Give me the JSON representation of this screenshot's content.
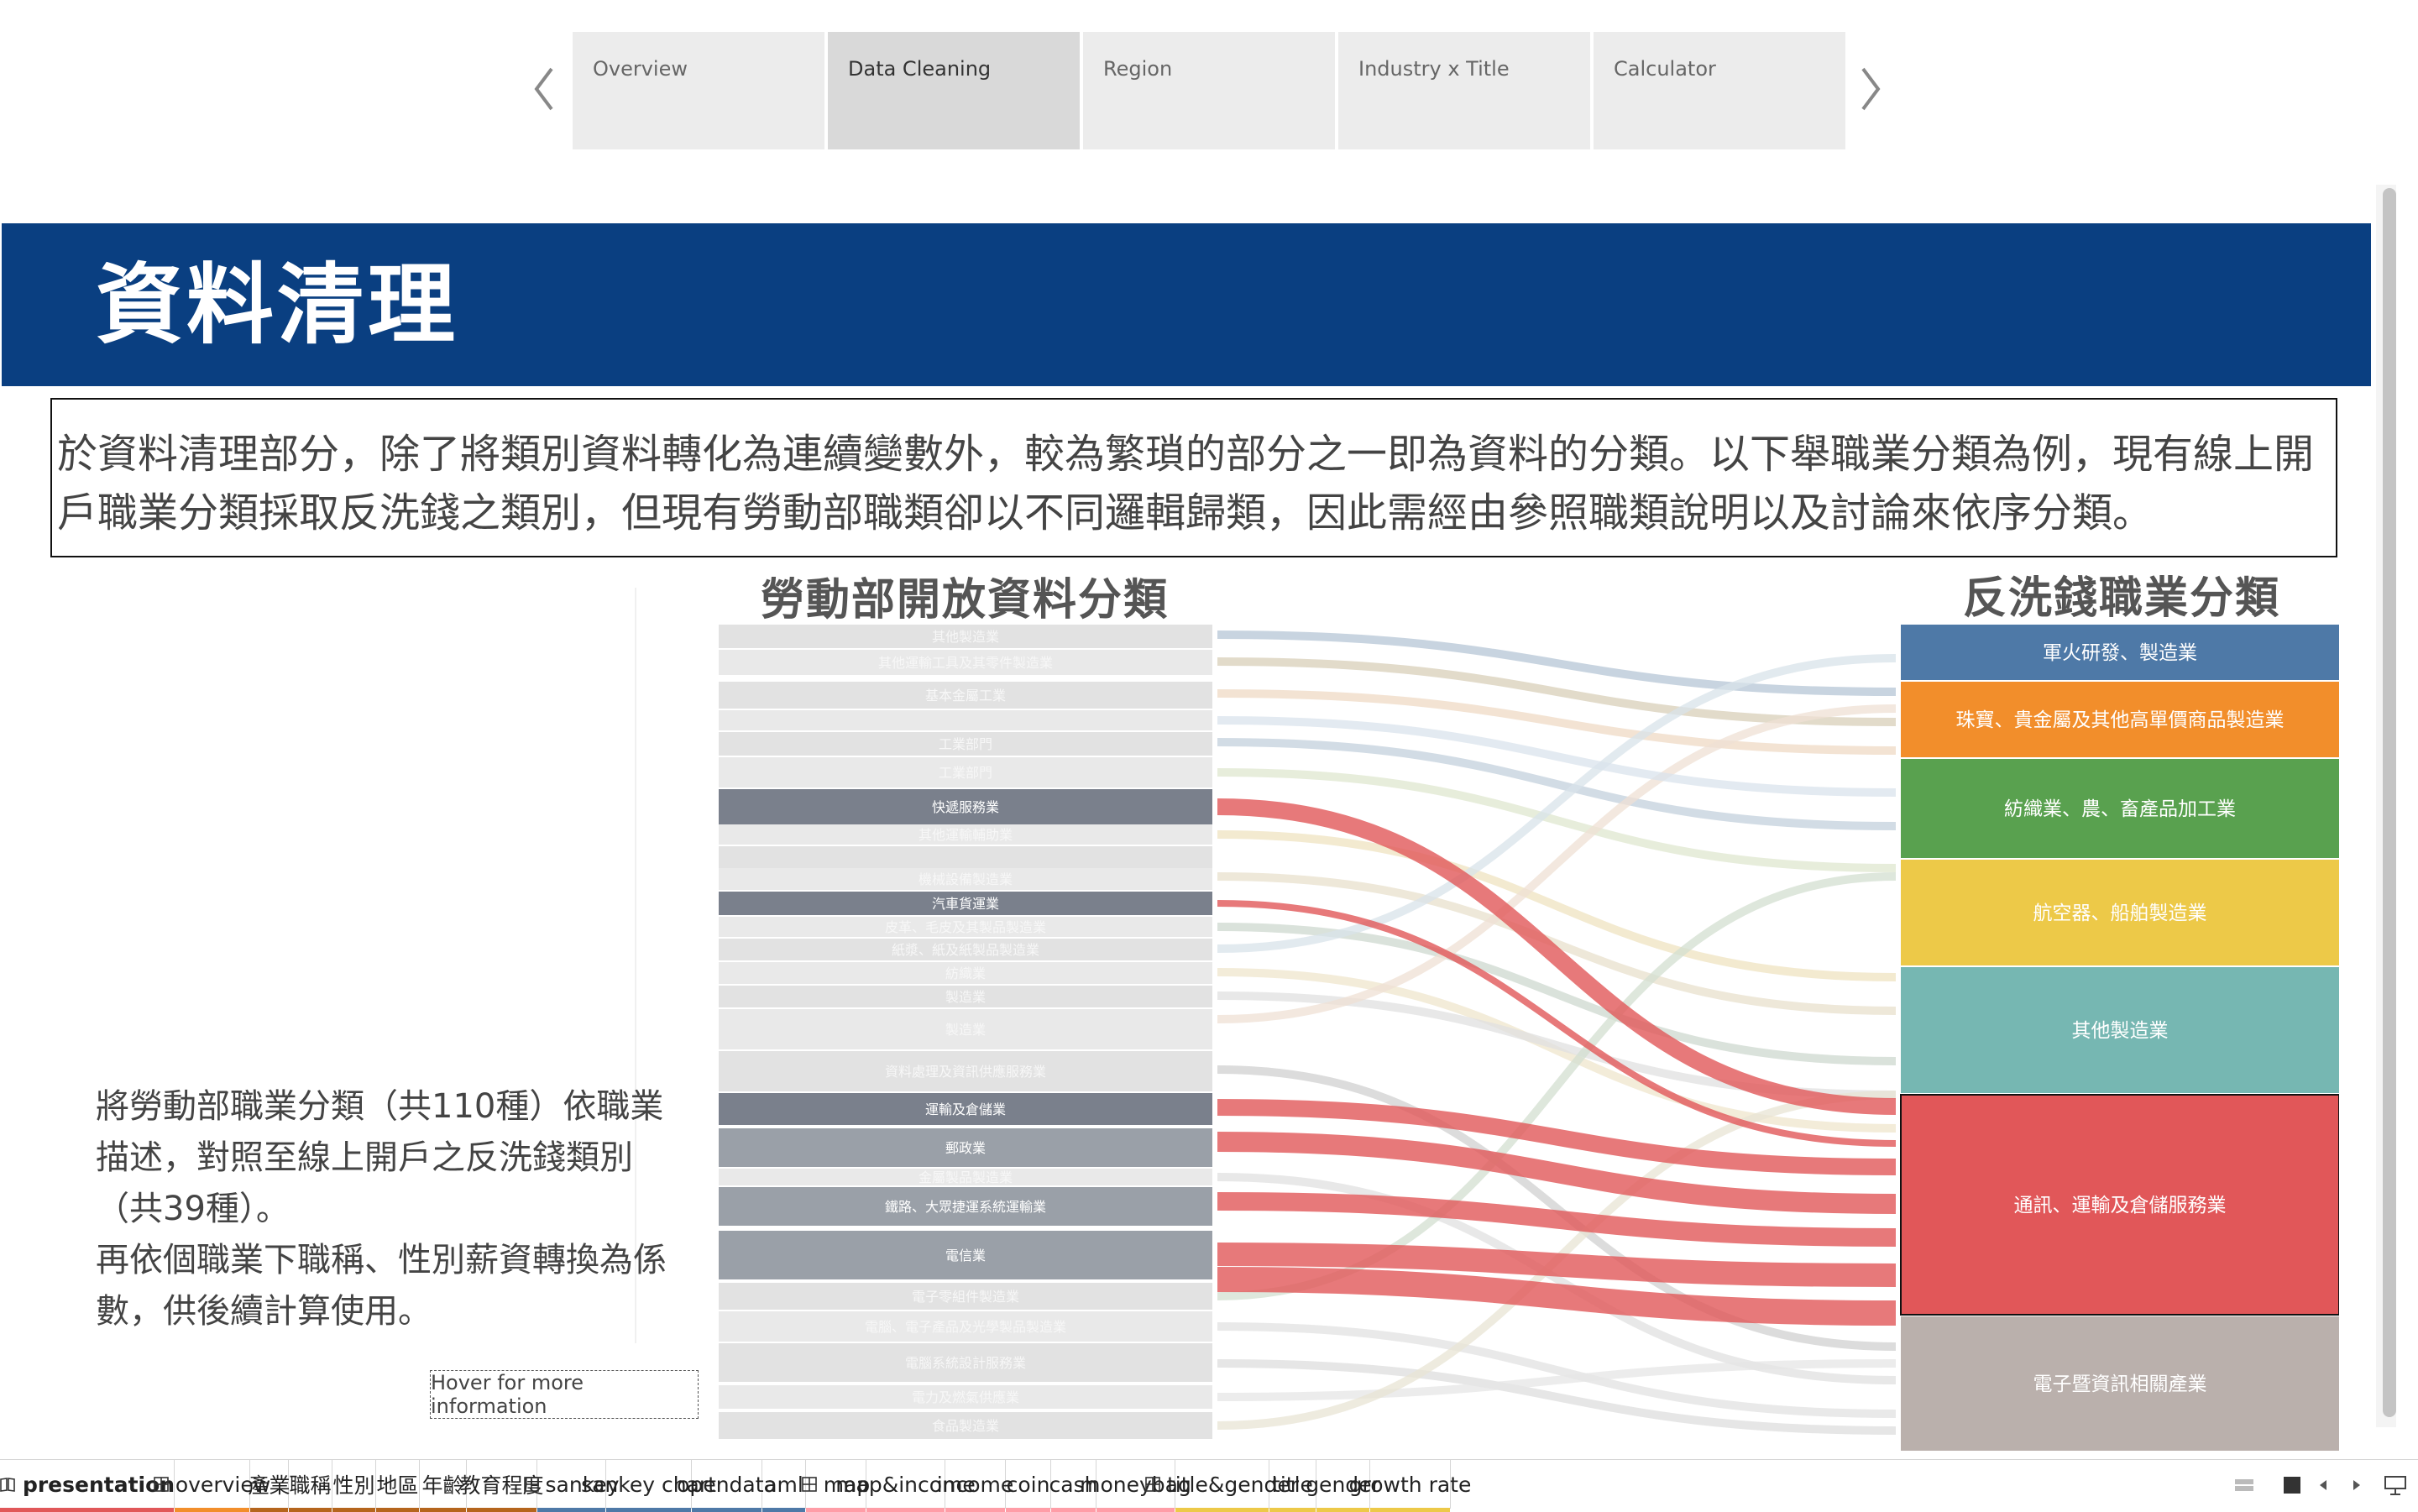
{
  "story": {
    "points": [
      {
        "label": "Overview",
        "active": false
      },
      {
        "label": "Data Cleaning",
        "active": true
      },
      {
        "label": "Region",
        "active": false
      },
      {
        "label": "Industry x Title",
        "active": false
      },
      {
        "label": "Calculator",
        "active": false
      }
    ]
  },
  "header": {
    "title": "資料清理"
  },
  "intro": {
    "text": "於資料清理部分，除了將類別資料轉化為連續變數外，較為繁瑣的部分之一即為資料的分類。以下舉職業分類為例，現有線上開戶職業分類採取反洗錢之類別，但現有勞動部職類卻以不同邏輯歸類，因此需經由參照職類說明以及討論來依序分類。"
  },
  "side_note": {
    "line1": "將勞動部職業分類（共110種）依職業描述，對照至線上開戶之反洗錢類別（共39種）。",
    "line2": "再依個職業下職稱、性別薪資轉換為係數，供後續計算使用。"
  },
  "hover_button": "Hover for more information",
  "sankey": {
    "left_title": "勞動部開放資料分類",
    "right_title": "反洗錢職業分類",
    "left_nodes": [
      {
        "label": "其他製造業",
        "highlight": false
      },
      {
        "label": "其他運輸工具及其零件製造業",
        "highlight": false
      },
      {
        "label": "基本金屬工業",
        "highlight": false
      },
      {
        "label": "",
        "highlight": false
      },
      {
        "label": "工業部門",
        "highlight": false
      },
      {
        "label": "工業部門",
        "highlight": false
      },
      {
        "label": "快遞服務業",
        "highlight": true
      },
      {
        "label": "其他運輸輔助業",
        "highlight": false
      },
      {
        "label": "",
        "highlight": false
      },
      {
        "label": "機械設備製造業",
        "highlight": false
      },
      {
        "label": "汽車貨運業",
        "highlight": true
      },
      {
        "label": "皮革、毛皮及其製品製造業",
        "highlight": false
      },
      {
        "label": "紙漿、紙及紙製品製造業",
        "highlight": false
      },
      {
        "label": "紡織業",
        "highlight": false
      },
      {
        "label": "製造業",
        "highlight": false
      },
      {
        "label": "製造業",
        "highlight": false
      },
      {
        "label": "資料處理及資訊供應服務業",
        "highlight": false
      },
      {
        "label": "運輸及倉儲業",
        "highlight": true
      },
      {
        "label": "郵政業",
        "highlight": true
      },
      {
        "label": "金屬製品製造業",
        "highlight": false
      },
      {
        "label": "鐵路、大眾捷運系統運輸業",
        "highlight": true
      },
      {
        "label": "電信業",
        "highlight": true
      },
      {
        "label": "電子零組件製造業",
        "highlight": false
      },
      {
        "label": "電腦、電子產品及光學製品製造業",
        "highlight": false
      },
      {
        "label": "電腦系統設計服務業",
        "highlight": false
      },
      {
        "label": "電力及燃氣供應業",
        "highlight": false
      },
      {
        "label": "食品製造業",
        "highlight": false
      }
    ],
    "right_nodes": [
      {
        "label": "軍火研發、製造業",
        "color": "#4e79a7"
      },
      {
        "label": "珠寶、貴金屬及其他高單價商品製造業",
        "color": "#f28e2b"
      },
      {
        "label": "紡織業、農、畜產品加工業",
        "color": "#59a14f"
      },
      {
        "label": "航空器、船舶製造業",
        "color": "#edc948"
      },
      {
        "label": "其他製造業",
        "color": "#76b7b2"
      },
      {
        "label": "通訊、運輸及倉儲服務業",
        "color": "#e15759"
      },
      {
        "label": "電子暨資訊相關產業",
        "color": "#bab0ac"
      }
    ]
  },
  "tabs": [
    {
      "label": "presentation",
      "icon": "story-icon",
      "active": true,
      "color": "#e15759"
    },
    {
      "label": "overview",
      "icon": "dashboard-icon",
      "active": false,
      "color": "#f28e2b"
    },
    {
      "label": "產業",
      "icon": "",
      "active": false,
      "color": "#b5651d"
    },
    {
      "label": "職稱",
      "icon": "",
      "active": false,
      "color": "#b5651d"
    },
    {
      "label": "性別",
      "icon": "",
      "active": false,
      "color": "#b5651d"
    },
    {
      "label": "地區",
      "icon": "",
      "active": false,
      "color": "#b5651d"
    },
    {
      "label": "年齡",
      "icon": "",
      "active": false,
      "color": "#b5651d"
    },
    {
      "label": "教育程度",
      "icon": "",
      "active": false,
      "color": "#b5651d"
    },
    {
      "label": "sankey",
      "icon": "dashboard-icon",
      "active": false,
      "color": "#4e79a7"
    },
    {
      "label": "sankey chart",
      "icon": "",
      "active": false,
      "color": "#4e79a7"
    },
    {
      "label": "opendata",
      "icon": "",
      "active": false,
      "color": "#4e79a7"
    },
    {
      "label": "aml",
      "icon": "",
      "active": false,
      "color": "#4e79a7"
    },
    {
      "label": "map",
      "icon": "dashboard-icon",
      "active": false,
      "color": "#ff9da7"
    },
    {
      "label": "map&income",
      "icon": "",
      "active": false,
      "color": "#ff9da7"
    },
    {
      "label": "income",
      "icon": "",
      "active": false,
      "color": "#ff9da7"
    },
    {
      "label": "coin",
      "icon": "",
      "active": false,
      "color": "#ff9da7"
    },
    {
      "label": "cash",
      "icon": "",
      "active": false,
      "color": "#ff9da7"
    },
    {
      "label": "moneybag",
      "icon": "",
      "active": false,
      "color": "#ff9da7"
    },
    {
      "label": "title&gender",
      "icon": "dashboard-icon",
      "active": false,
      "color": "#edc948"
    },
    {
      "label": "title",
      "icon": "",
      "active": false,
      "color": "#edc948"
    },
    {
      "label": "gender",
      "icon": "",
      "active": false,
      "color": "#edc948"
    },
    {
      "label": "growth rate",
      "icon": "",
      "active": false,
      "color": "#edc948"
    }
  ],
  "colors": {
    "banner": "#0a3f81",
    "highlight_flow": "#e15759",
    "highlight_node": "#7a808c"
  }
}
